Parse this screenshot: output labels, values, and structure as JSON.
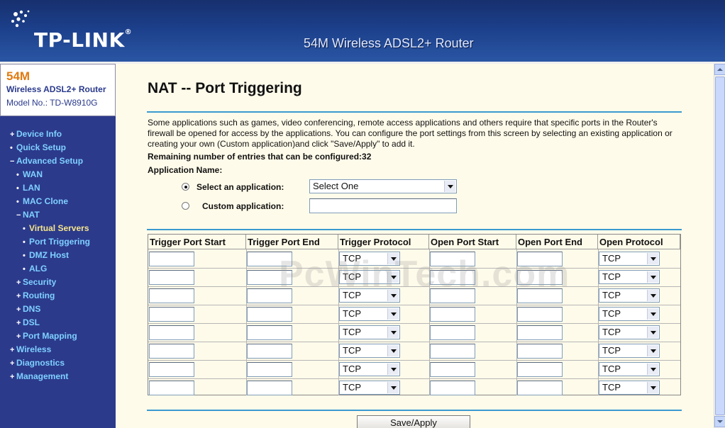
{
  "header": {
    "logo_text": "TP-LINK",
    "logo_mark": "®",
    "product_title": "54M Wireless ADSL2+ Router"
  },
  "sidebar": {
    "brand_speed": "54M",
    "brand_product": "Wireless ADSL2+ Router",
    "brand_model": "Model No.: TD-W8910G",
    "items": [
      {
        "marker": "+",
        "label": "Device Info",
        "level": 0
      },
      {
        "marker": "•",
        "label": "Quick Setup",
        "level": 0
      },
      {
        "marker": "−",
        "label": "Advanced Setup",
        "level": 0
      },
      {
        "marker": "•",
        "label": "WAN",
        "level": 1
      },
      {
        "marker": "•",
        "label": "LAN",
        "level": 1
      },
      {
        "marker": "•",
        "label": "MAC Clone",
        "level": 1
      },
      {
        "marker": "−",
        "label": "NAT",
        "level": 1
      },
      {
        "marker": "•",
        "label": "Virtual Servers",
        "level": 2,
        "current": true
      },
      {
        "marker": "•",
        "label": "Port Triggering",
        "level": 2
      },
      {
        "marker": "•",
        "label": "DMZ Host",
        "level": 2
      },
      {
        "marker": "•",
        "label": "ALG",
        "level": 2
      },
      {
        "marker": "+",
        "label": "Security",
        "level": 1
      },
      {
        "marker": "+",
        "label": "Routing",
        "level": 1
      },
      {
        "marker": "+",
        "label": "DNS",
        "level": 1
      },
      {
        "marker": "+",
        "label": "DSL",
        "level": 1
      },
      {
        "marker": "+",
        "label": "Port Mapping",
        "level": 1
      },
      {
        "marker": "+",
        "label": "Wireless",
        "level": 0
      },
      {
        "marker": "+",
        "label": "Diagnostics",
        "level": 0
      },
      {
        "marker": "+",
        "label": "Management",
        "level": 0
      }
    ]
  },
  "main": {
    "title": "NAT -- Port Triggering",
    "description": "Some applications such as games, video conferencing, remote access applications and others require that specific ports in the Router's firewall be opened for access by the applications. You can configure the port settings from this screen by selecting an existing application or creating your own (Custom application)and click \"Save/Apply\" to add it.",
    "remaining": "Remaining number of entries that can be configured:32",
    "app_name_label": "Application Name:",
    "select_app_label": "Select an application:",
    "select_app_value": "Select One",
    "custom_app_label": "Custom application:",
    "custom_app_value": "",
    "save_label": "Save/Apply"
  },
  "table": {
    "headers": [
      "Trigger Port Start",
      "Trigger Port End",
      "Trigger Protocol",
      "Open Port Start",
      "Open Port End",
      "Open Protocol"
    ],
    "rows": [
      {
        "trigger_start": "",
        "trigger_end": "",
        "trigger_protocol": "TCP",
        "open_start": "",
        "open_end": "",
        "open_protocol": "TCP"
      },
      {
        "trigger_start": "",
        "trigger_end": "",
        "trigger_protocol": "TCP",
        "open_start": "",
        "open_end": "",
        "open_protocol": "TCP"
      },
      {
        "trigger_start": "",
        "trigger_end": "",
        "trigger_protocol": "TCP",
        "open_start": "",
        "open_end": "",
        "open_protocol": "TCP"
      },
      {
        "trigger_start": "",
        "trigger_end": "",
        "trigger_protocol": "TCP",
        "open_start": "",
        "open_end": "",
        "open_protocol": "TCP"
      },
      {
        "trigger_start": "",
        "trigger_end": "",
        "trigger_protocol": "TCP",
        "open_start": "",
        "open_end": "",
        "open_protocol": "TCP"
      },
      {
        "trigger_start": "",
        "trigger_end": "",
        "trigger_protocol": "TCP",
        "open_start": "",
        "open_end": "",
        "open_protocol": "TCP"
      },
      {
        "trigger_start": "",
        "trigger_end": "",
        "trigger_protocol": "TCP",
        "open_start": "",
        "open_end": "",
        "open_protocol": "TCP"
      },
      {
        "trigger_start": "",
        "trigger_end": "",
        "trigger_protocol": "TCP",
        "open_start": "",
        "open_end": "",
        "open_protocol": "TCP"
      }
    ]
  },
  "watermark": "PcWinTech.com",
  "colors": {
    "header_blue": "#1c3f8a",
    "sidebar_blue": "#2c3a8c",
    "menu_text": "#7fd1ff",
    "menu_current": "#f5e58a",
    "brand_orange": "#e07a10",
    "content_bg": "#fffbea",
    "rule": "#3a9ad0"
  }
}
